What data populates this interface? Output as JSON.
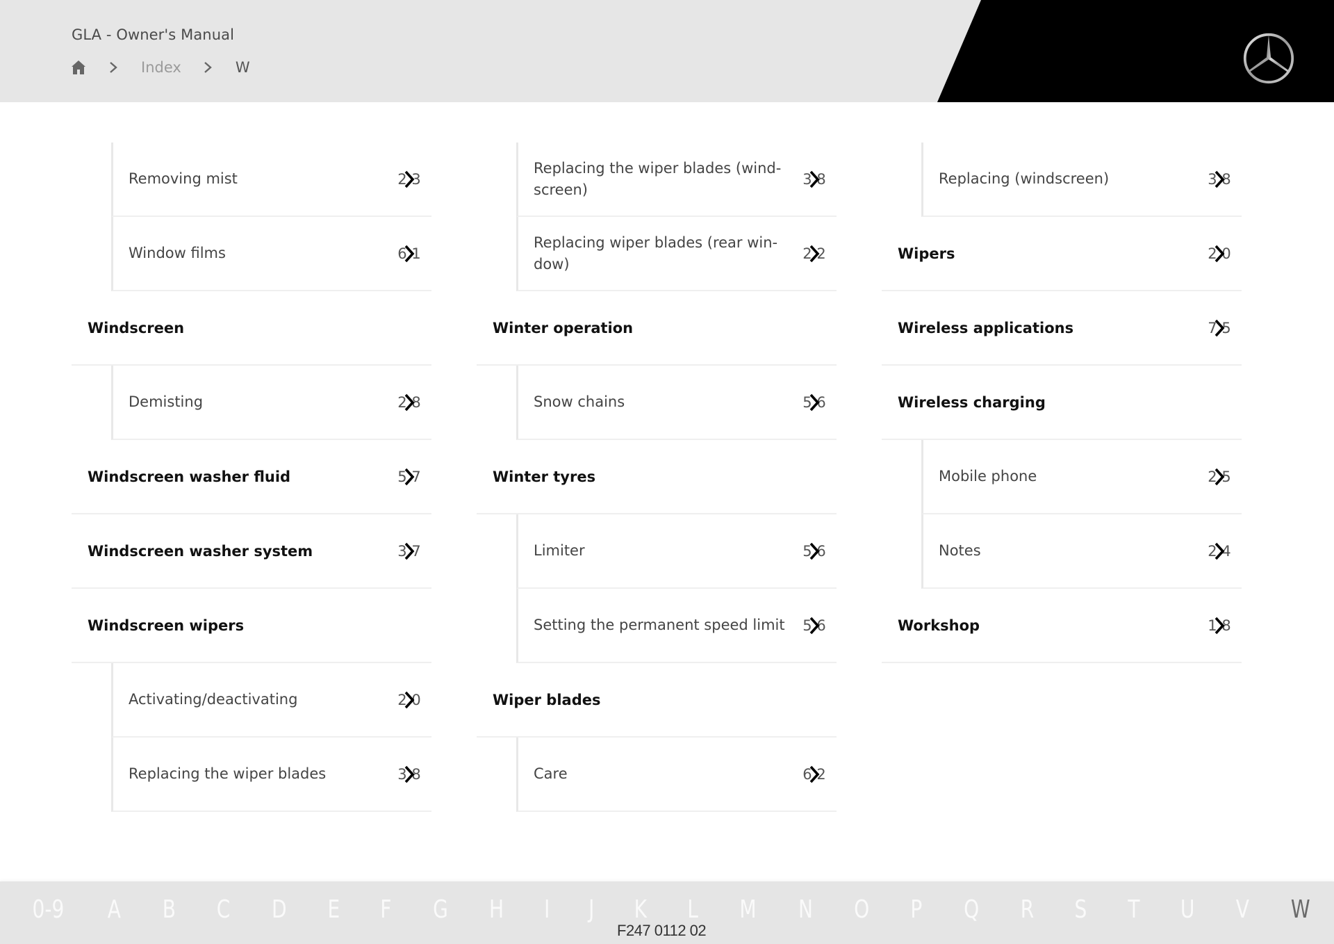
{
  "header": {
    "app_title": "GLA - Owner's Manual",
    "breadcrumb": {
      "home_icon": "home-icon",
      "separator_icon": "chevron-right-icon",
      "items": [
        "Index",
        "W"
      ]
    },
    "logo": "mercedes-star-logo"
  },
  "index": {
    "letter": "W",
    "columns": [
      [
        {
          "type": "child",
          "label": "Removing mist",
          "page": "2 3"
        },
        {
          "type": "child",
          "label": "Window films",
          "page": "6 1"
        },
        {
          "type": "group",
          "label": "Windscreen",
          "page": ""
        },
        {
          "type": "child",
          "label": "Demisting",
          "page": "2 8"
        },
        {
          "type": "group",
          "label": "Windscreen washer fluid",
          "page": "5 7"
        },
        {
          "type": "group",
          "label": "Windscreen washer system",
          "page": "3 7"
        },
        {
          "type": "group",
          "label": "Windscreen wipers",
          "page": ""
        },
        {
          "type": "child",
          "label": "Activating/deactivating",
          "page": "2 0"
        },
        {
          "type": "child",
          "label": "Replacing the wiper blades",
          "page": "3 8"
        }
      ],
      [
        {
          "type": "child",
          "label": "Replacing the wiper blades (wind-screen)",
          "page": "3 8"
        },
        {
          "type": "child",
          "label": "Replacing wiper blades (rear win-dow)",
          "page": "2 2"
        },
        {
          "type": "group",
          "label": "Winter operation",
          "page": ""
        },
        {
          "type": "child",
          "label": "Snow chains",
          "page": "5 6"
        },
        {
          "type": "group",
          "label": "Winter tyres",
          "page": ""
        },
        {
          "type": "child",
          "label": "Limiter",
          "page": "5 6"
        },
        {
          "type": "child",
          "label": "Setting the permanent speed limit",
          "page": "5 6"
        },
        {
          "type": "group",
          "label": "Wiper blades",
          "page": ""
        },
        {
          "type": "child",
          "label": "Care",
          "page": "6 2"
        }
      ],
      [
        {
          "type": "child",
          "label": "Replacing (windscreen)",
          "page": "3 8"
        },
        {
          "type": "group",
          "label": "Wipers",
          "page": "2 0"
        },
        {
          "type": "group",
          "label": "Wireless applications",
          "page": "7 5"
        },
        {
          "type": "group",
          "label": "Wireless charging",
          "page": ""
        },
        {
          "type": "child",
          "label": "Mobile phone",
          "page": "2 5"
        },
        {
          "type": "child",
          "label": "Notes",
          "page": "2 4"
        },
        {
          "type": "group",
          "label": "Workshop",
          "page": "1 8"
        }
      ]
    ],
    "page_link_icon": "chevron-right-icon"
  },
  "footer": {
    "alphabet": [
      "0-9",
      "A",
      "B",
      "C",
      "D",
      "E",
      "F",
      "G",
      "H",
      "I",
      "J",
      "K",
      "L",
      "M",
      "N",
      "O",
      "P",
      "Q",
      "R",
      "S",
      "T",
      "U",
      "V",
      "W"
    ],
    "active_letter": "W",
    "doc_id": "F247 0112 02"
  },
  "colors": {
    "header_bg": "#e6e6e6",
    "header_accent": "#000000",
    "footer_bg": "#e5e5e5",
    "divider": "#efefef"
  }
}
